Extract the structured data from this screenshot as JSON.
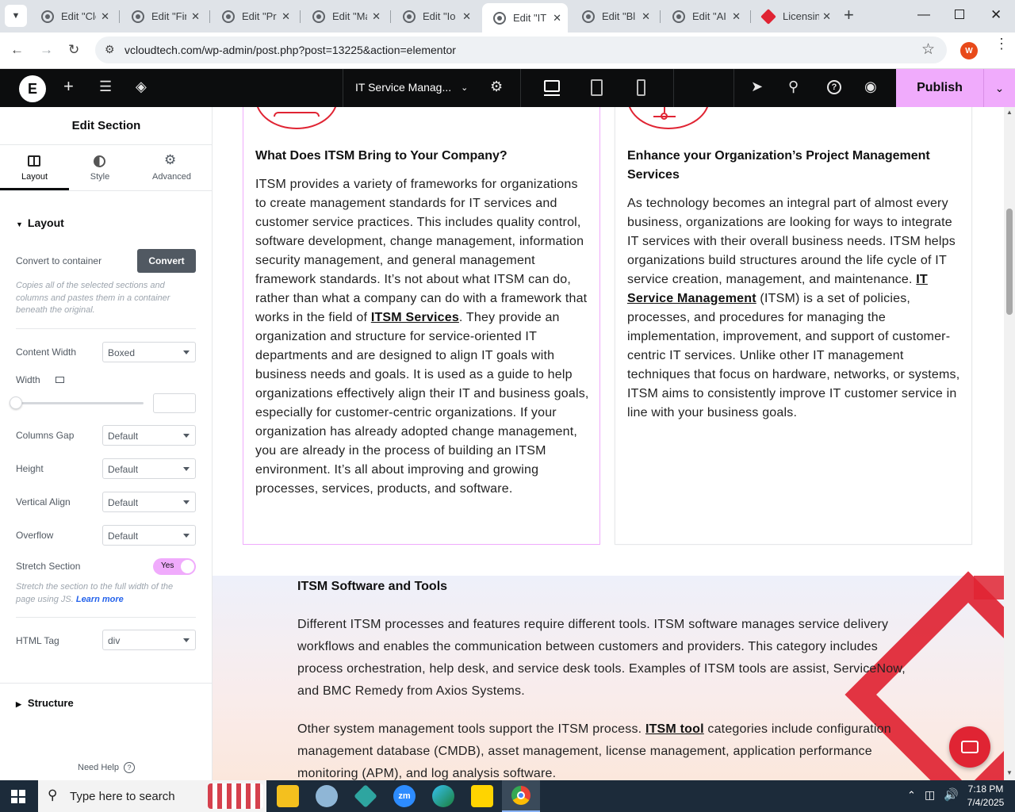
{
  "browser": {
    "tabs": [
      {
        "label": "Edit \"Clo"
      },
      {
        "label": "Edit \"Fin"
      },
      {
        "label": "Edit \"Pro"
      },
      {
        "label": "Edit \"Ma"
      },
      {
        "label": "Edit \"Io"
      },
      {
        "label": "Edit \"IT",
        "active": true
      },
      {
        "label": "Edit \"Bl"
      },
      {
        "label": "Edit \"AI"
      },
      {
        "label": "Licensin"
      }
    ],
    "url": "vcloudtech.com/wp-admin/post.php?post=13225&action=elementor",
    "profile_initial": "W"
  },
  "topbar": {
    "page_title": "IT Service Manag...",
    "publish_label": "Publish"
  },
  "panel": {
    "title": "Edit Section",
    "tabs": [
      {
        "label": "Layout",
        "icon": "layout-icon",
        "active": true
      },
      {
        "label": "Style",
        "icon": "style-icon"
      },
      {
        "label": "Advanced",
        "icon": "gear-icon"
      }
    ],
    "layout_heading": "Layout",
    "convert_label": "Convert to container",
    "convert_button": "Convert",
    "convert_note": "Copies all of the selected sections and columns and pastes them in a container beneath the original.",
    "content_width_label": "Content Width",
    "content_width_value": "Boxed",
    "width_label": "Width",
    "columns_gap_label": "Columns Gap",
    "columns_gap_value": "Default",
    "height_label": "Height",
    "height_value": "Default",
    "vertical_align_label": "Vertical Align",
    "vertical_align_value": "Default",
    "overflow_label": "Overflow",
    "overflow_value": "Default",
    "stretch_label": "Stretch Section",
    "stretch_value": "Yes",
    "stretch_note": "Stretch the section to the full width of the page using JS.",
    "learn_more": "Learn more",
    "html_tag_label": "HTML Tag",
    "html_tag_value": "div",
    "structure_heading": "Structure",
    "need_help": "Need Help"
  },
  "content": {
    "card1": {
      "title": "What Does ITSM Bring to Your Company?",
      "body_before": "ITSM provides a variety of frameworks for organizations to create management standards for IT services and customer service practices. This includes quality control, software development, change management, information security management, and general management framework standards. It’s not about what ITSM can do, rather than what a company can do with a framework that works in the field of ",
      "link": "ITSM Services",
      "body_after": ". They provide an organization and structure for service-oriented IT departments and are designed to align IT goals with business needs and goals. It is used as a guide to help organizations effectively align their IT and business goals, especially for customer-centric organizations. If your organization has already adopted change management, you are already in the process of building an ITSM environment. It’s all about improving and growing processes, services, products, and software."
    },
    "card2": {
      "title": "Enhance your Organization’s Project Management Services",
      "body_before": "As technology becomes an integral part of almost every business, organizations are looking for ways to integrate IT services with their overall business needs. ITSM helps organizations build structures around the life cycle of IT service creation, management, and maintenance. ",
      "link": "IT Service Management",
      "body_after": " (ITSM) is a set of policies, processes, and procedures for managing the implementation, improvement, and support of customer-centric IT services. Unlike other IT management techniques that focus on hardware, networks, or systems, ITSM aims to consistently improve IT customer service in line with your business goals."
    },
    "section2": {
      "title": "ITSM Software and Tools",
      "para1": "Different ITSM processes and features require different tools. ITSM software manages service delivery workflows and enables the communication between customers and providers. This category includes process orchestration, help desk, and service desk tools. Examples of ITSM tools are assist, ServiceNow, and BMC Remedy from Axios Systems.",
      "para2_before": "Other system management tools support the ITSM process. ",
      "para2_link": "ITSM tool",
      "para2_after": " categories include configuration management database (CMDB), asset management, license management, application performance monitoring (APM), and log analysis software."
    }
  },
  "taskbar": {
    "search_placeholder": "Type here to search",
    "time": "7:18 PM",
    "date": "7/4/2025"
  },
  "colors": {
    "accent_pink": "#f0abfc",
    "brand_red": "#e02433",
    "topbar_bg": "#0c0d0e"
  }
}
